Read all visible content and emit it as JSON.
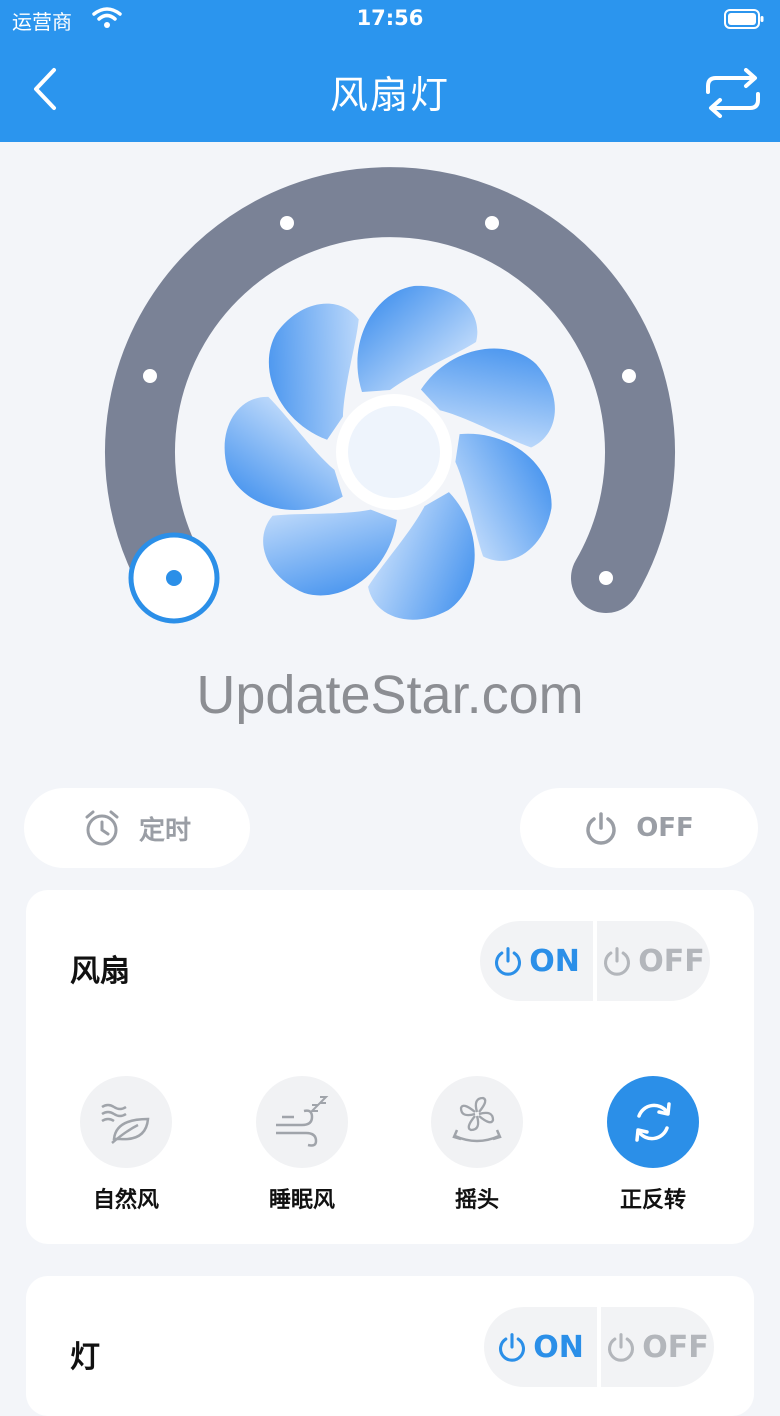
{
  "status_bar": {
    "carrier": "运营商",
    "time": "17:56"
  },
  "nav": {
    "title": "风扇灯",
    "back_icon": "chevron-left-icon",
    "switch_icon": "repeat-icon"
  },
  "dial": {
    "level_index": 0,
    "level_count": 7,
    "colors": {
      "track": "#7a8296",
      "thumb": "#2b8fe8"
    }
  },
  "watermark": "UpdateStar.com",
  "quick_actions": {
    "timer_label": "定时",
    "power_label": "OFF"
  },
  "fan_card": {
    "title": "风扇",
    "on_label": "ON",
    "off_label": "OFF",
    "modes": [
      {
        "label": "自然风",
        "icon": "leaf-wind-icon",
        "active": false
      },
      {
        "label": "睡眠风",
        "icon": "sleep-wind-icon",
        "active": false
      },
      {
        "label": "摇头",
        "icon": "oscillate-icon",
        "active": false
      },
      {
        "label": "正反转",
        "icon": "reverse-rotate-icon",
        "active": true
      }
    ]
  },
  "light_card": {
    "title": "灯",
    "on_label": "ON",
    "off_label": "OFF"
  },
  "colors": {
    "brand": "#2b95ee",
    "active": "#2b8fe8",
    "inactive_text": "#b3b6bb"
  }
}
